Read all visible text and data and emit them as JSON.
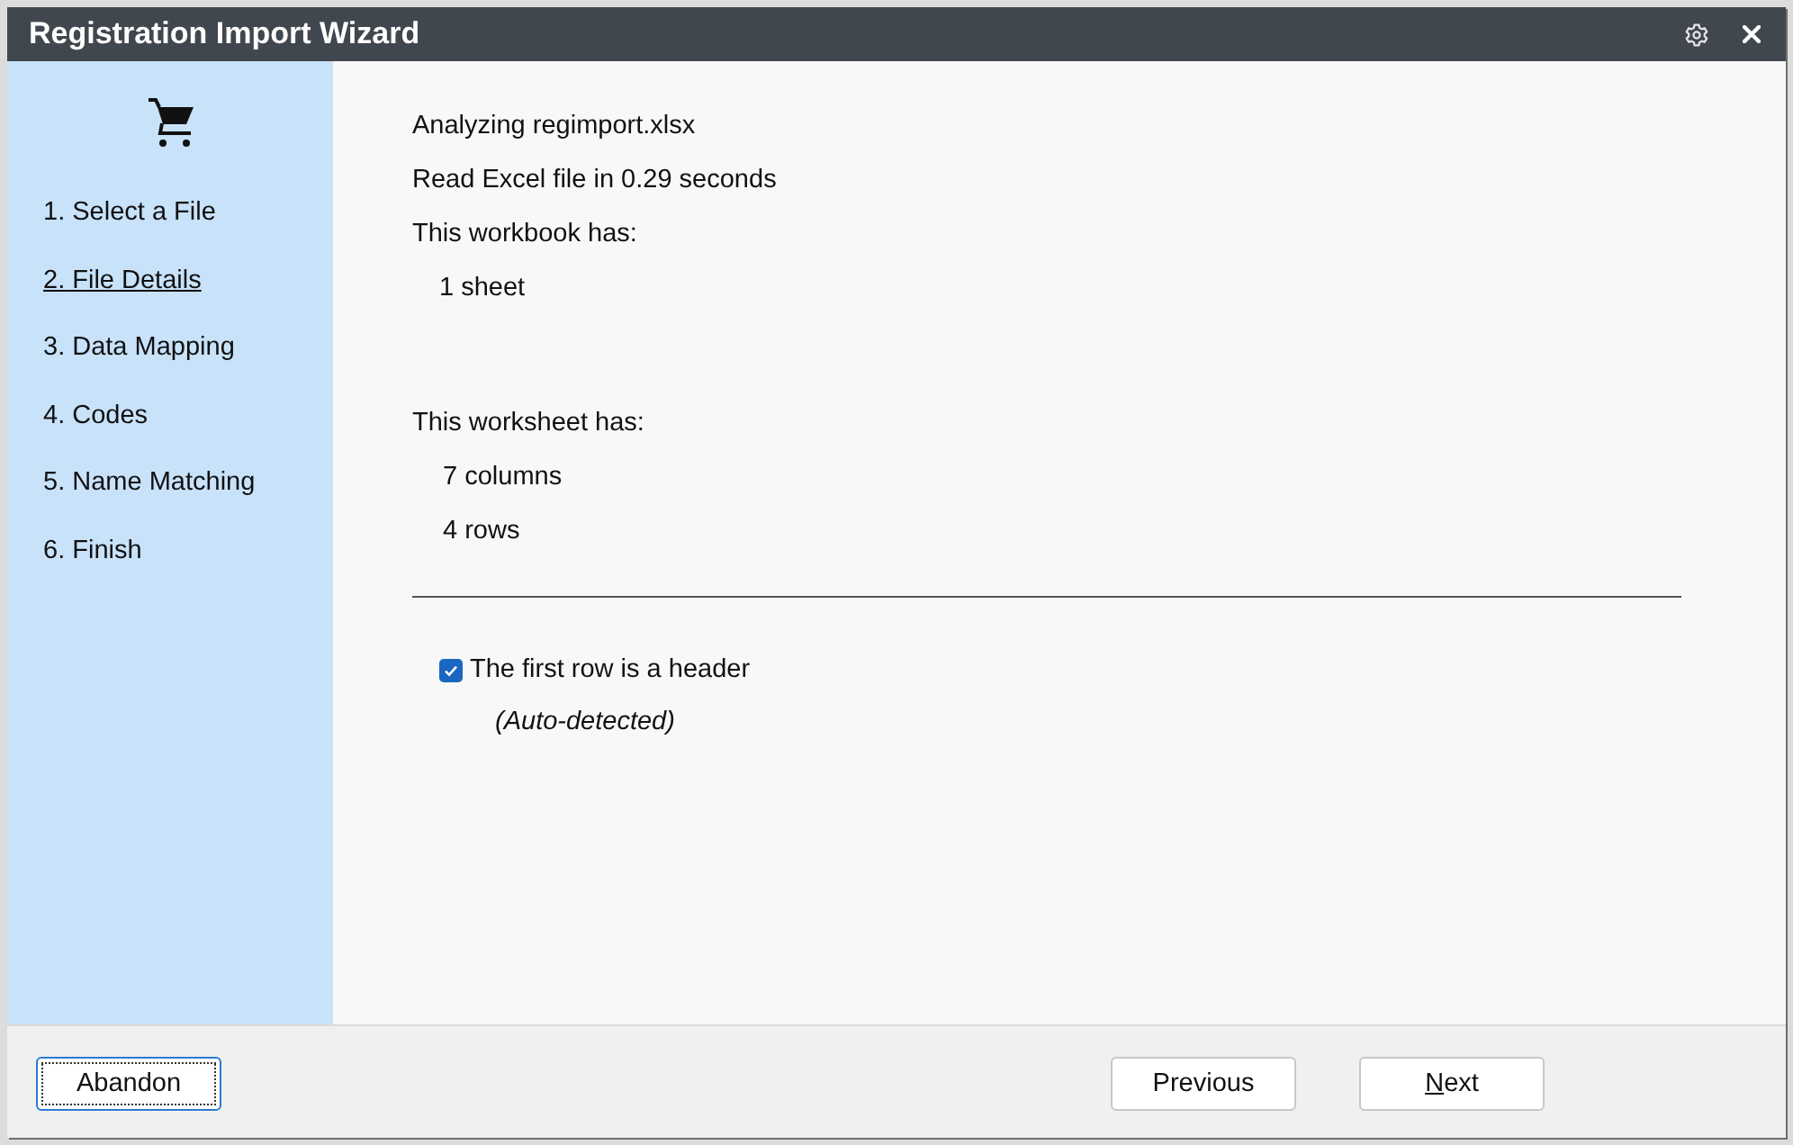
{
  "window": {
    "title": "Registration Import Wizard"
  },
  "sidebar": {
    "steps": [
      {
        "label": "1. Select a File",
        "selected": false
      },
      {
        "label": "2. File Details",
        "selected": true
      },
      {
        "label": "3. Data Mapping",
        "selected": false
      },
      {
        "label": "4. Codes",
        "selected": false
      },
      {
        "label": "5. Name Matching",
        "selected": false
      },
      {
        "label": "6. Finish",
        "selected": false
      }
    ]
  },
  "summary": [
    "Analyzing regimport.xlsx",
    "Read Excel file in 0.29 seconds"
  ],
  "workbook": {
    "heading": "This workbook has:",
    "items": [
      "1 sheet"
    ]
  },
  "worksheet": {
    "heading": "This worksheet has:",
    "items": [
      "7 columns",
      "4 rows"
    ]
  },
  "header_option": {
    "label": "The first row is a header",
    "checked": true,
    "note": "(Auto-detected)"
  },
  "footer": {
    "left_buttons": [
      {
        "label": "Abandon",
        "focused": true,
        "mnemonic_underlined": false
      }
    ],
    "right_buttons": [
      {
        "label": "Previous",
        "focused": false,
        "mnemonic_underlined": false
      },
      {
        "label": "Next",
        "focused": false,
        "mnemonic_underlined": true
      }
    ]
  }
}
